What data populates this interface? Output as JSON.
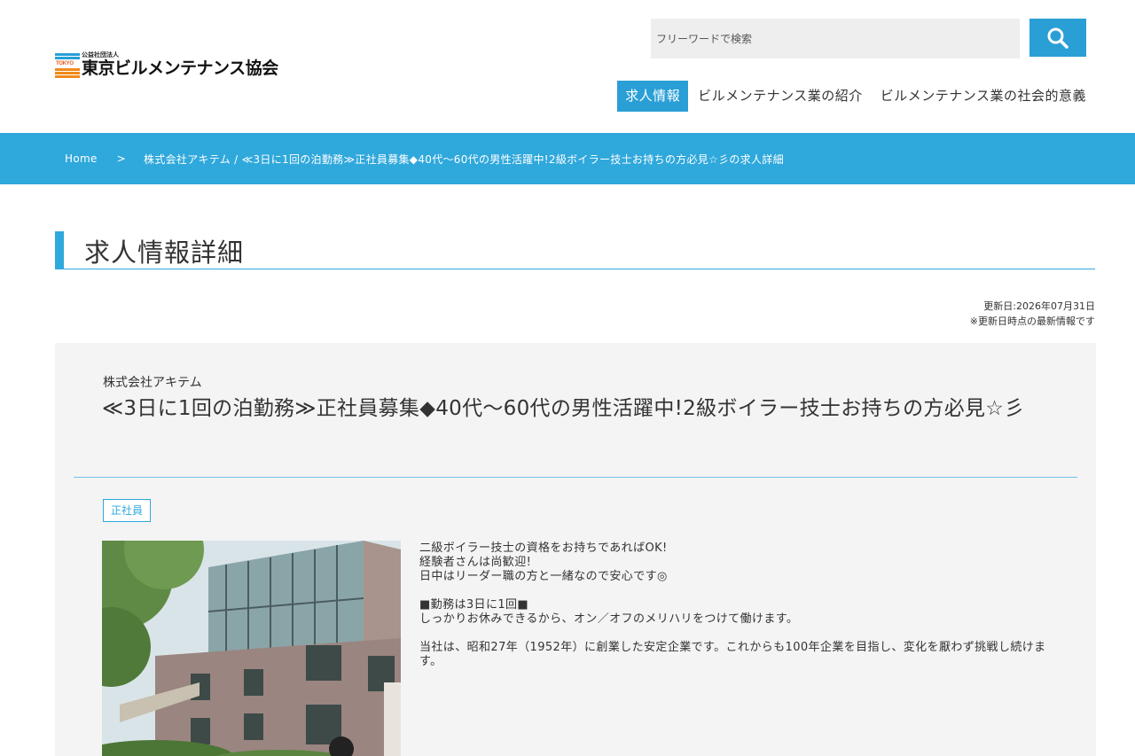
{
  "header": {
    "logo_sub": "公益社団法人",
    "logo_main": "東京ビルメンテナンス協会",
    "logo_mark_text": "TOKYO",
    "search_placeholder": "フリーワードで検索",
    "nav": [
      {
        "label": "求人情報",
        "active": true
      },
      {
        "label": "ビルメンテナンス業の紹介",
        "active": false
      },
      {
        "label": "ビルメンテナンス業の社会的意義",
        "active": false
      }
    ]
  },
  "breadcrumb": {
    "home": "Home",
    "separator": ">",
    "current": "株式会社アキテム / ≪3日に1回の泊勤務≫正社員募集◆40代～60代の男性活躍中!2級ボイラー技士お持ちの方必見☆彡の求人詳細"
  },
  "page_title": "求人情報詳細",
  "updated": {
    "date": "更新日:2026年07月31日",
    "note": "※更新日時点の最新情報です"
  },
  "job": {
    "company": "株式会社アキテム",
    "title": "≪3日に1回の泊勤務≫正社員募集◆40代～60代の男性活躍中!2級ボイラー技士お持ちの方必見☆彡",
    "employment_type": "正社員",
    "description": {
      "p1_l1": "二級ボイラー技士の資格をお持ちであればOK!",
      "p1_l2": "経験者さんは尚歓迎!",
      "p1_l3": "日中はリーダー職の方と一緒なので安心です◎",
      "p2_l1": "■勤務は3日に1回■",
      "p2_l2": "しっかりお休みできるから、オン／オフのメリハリをつけて働けます。",
      "p3_l1": "当社は、昭和27年（1952年）に創業した安定企業です。これからも100年企業を目指し、変化を厭わず挑戦し続けます。"
    }
  },
  "colors": {
    "accent": "#2fa8dc",
    "card_bg": "#f4f4f4",
    "search_bg": "#eeeeee"
  },
  "icons": {
    "search": "search-icon"
  }
}
